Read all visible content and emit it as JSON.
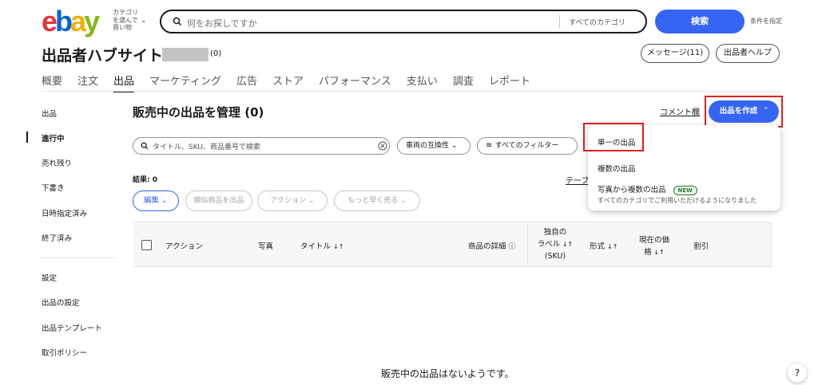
{
  "header": {
    "logo_text": "ebay",
    "logo_colors": [
      "#e53238",
      "#0064d2",
      "#f5af02",
      "#86b817"
    ],
    "shop_by_category": [
      "カテゴリ",
      "を選んで",
      "買い物"
    ],
    "search_placeholder": "何をお探しですか",
    "search_category": "すべてのカテゴリ",
    "search_button": "検索",
    "advanced": "条件を指定"
  },
  "hub": {
    "title": "出品者ハブサイト",
    "score": "(0)",
    "messages_button": "メッセージ(11)",
    "help_button": "出品者ヘルプ"
  },
  "tabs": [
    {
      "label": "概要",
      "active": false
    },
    {
      "label": "注文",
      "active": false
    },
    {
      "label": "出品",
      "active": true
    },
    {
      "label": "マーケティング",
      "active": false
    },
    {
      "label": "広告",
      "active": false
    },
    {
      "label": "ストア",
      "active": false
    },
    {
      "label": "パフォーマンス",
      "active": false
    },
    {
      "label": "支払い",
      "active": false
    },
    {
      "label": "調査",
      "active": false
    },
    {
      "label": "レポート",
      "active": false
    }
  ],
  "sidebar": {
    "items": [
      "出品",
      "進行中",
      "売れ残り",
      "下書き",
      "日時指定済み",
      "終了済み",
      "設定",
      "出品の設定",
      "出品テンプレート",
      "取引ポリシー"
    ],
    "active": "進行中"
  },
  "main": {
    "title": "販売中の出品を管理 (0)",
    "comment_link": "コメント欄",
    "create_button": "出品を作成",
    "filter_placeholder": "タイトル、SKU、商品番号で検索",
    "chip_compat": "車両の互換性",
    "chip_filters": "すべてのフィルター",
    "result": "結果: 0",
    "table_link": "テーブ",
    "edit_button": "編集",
    "similar_button": "類似商品を出品",
    "action_button": "アクション",
    "sell_faster_button": "もっと早く売る",
    "empty_message": "販売中の出品はないようです。",
    "help": "?"
  },
  "table": {
    "headers": {
      "action": "アクション",
      "photo": "写真",
      "title": "タイトル",
      "details": "商品の詳細",
      "label_1": "独自の",
      "label_2": "ラベル",
      "label_3": "(SKU)",
      "format": "形式",
      "price_1": "現在の価",
      "price_2": "格",
      "discount": "割引"
    }
  },
  "dropdown": {
    "items": [
      "単一の出品",
      "複数の出品",
      "写真から複数の出品"
    ],
    "badge": "NEW",
    "subtext": "すべてのカテゴリでご利用いただけるようになりました"
  },
  "colors": {
    "primary": "#3665f3",
    "highlight": "#e0201b"
  }
}
